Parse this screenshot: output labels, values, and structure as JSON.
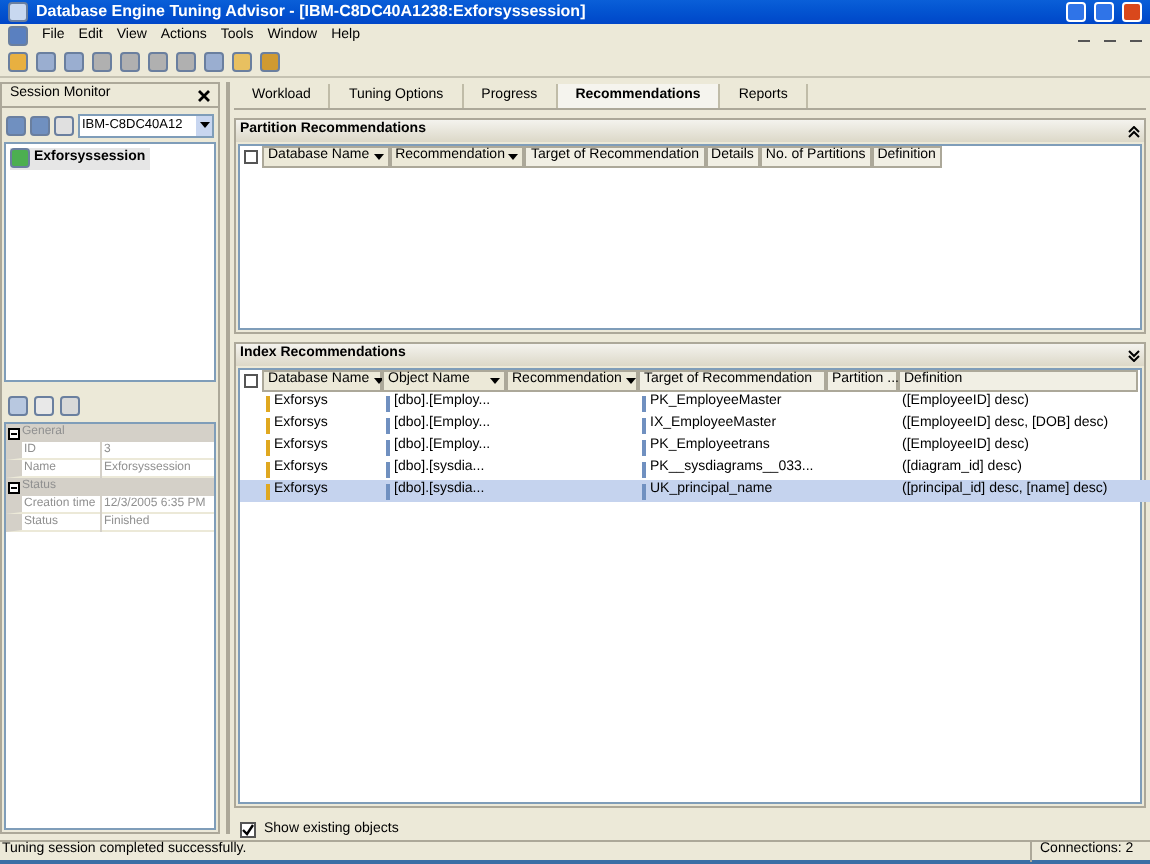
{
  "window": {
    "title": "Database Engine Tuning Advisor - [IBM-C8DC40A1238:Exforsyssession]"
  },
  "menu": [
    "File",
    "Edit",
    "View",
    "Actions",
    "Tools",
    "Window",
    "Help"
  ],
  "session_monitor": {
    "title": "Session Monitor",
    "server": "IBM-C8DC40A12",
    "sessions": [
      {
        "label": "Exforsyssession",
        "selected": true
      }
    ],
    "properties": [
      {
        "category": "General",
        "rows": [
          {
            "name": "ID",
            "value": "3"
          },
          {
            "name": "Name",
            "value": "Exforsyssession"
          }
        ]
      },
      {
        "category": "Status",
        "rows": [
          {
            "name": "Creation time",
            "value": "12/3/2005 6:35 PM"
          },
          {
            "name": "Status",
            "value": "Finished"
          }
        ]
      }
    ]
  },
  "tabs": [
    {
      "label": "Workload",
      "selected": false
    },
    {
      "label": "Tuning Options",
      "selected": false
    },
    {
      "label": "Progress",
      "selected": false
    },
    {
      "label": "Recommendations",
      "selected": true
    },
    {
      "label": "Reports",
      "selected": false
    }
  ],
  "partition_recommendations": {
    "title": "Partition Recommendations",
    "select_all_checked": false,
    "columns": [
      {
        "label": "Database Name",
        "dropdown": true
      },
      {
        "label": "Recommendation",
        "dropdown": true
      },
      {
        "label": "Target of Recommendation",
        "dropdown": false
      },
      {
        "label": "Details",
        "dropdown": false
      },
      {
        "label": "No. of Partitions",
        "dropdown": false
      },
      {
        "label": "Definition",
        "dropdown": false
      }
    ]
  },
  "index_recommendations": {
    "title": "Index Recommendations",
    "select_all_checked": false,
    "columns": [
      {
        "label": "Database Name",
        "dropdown": true
      },
      {
        "label": "Object Name",
        "dropdown": true
      },
      {
        "label": "Recommendation",
        "dropdown": true
      },
      {
        "label": "Target of Recommendation",
        "dropdown": false
      },
      {
        "label": "Partition ...",
        "dropdown": false
      },
      {
        "label": "Definition",
        "dropdown": false
      }
    ],
    "rows": [
      {
        "database": "Exforsys",
        "object": "[dbo].[Employ...",
        "target": "PK_EmployeeMaster",
        "definition": "([EmployeeID] desc)",
        "selected": false
      },
      {
        "database": "Exforsys",
        "object": "[dbo].[Employ...",
        "target": "IX_EmployeeMaster",
        "definition": "([EmployeeID] desc, [DOB] desc)",
        "selected": false
      },
      {
        "database": "Exforsys",
        "object": "[dbo].[Employ...",
        "target": "PK_Employeetrans",
        "definition": "([EmployeeID] desc)",
        "selected": false
      },
      {
        "database": "Exforsys",
        "object": "[dbo].[sysdia...",
        "target": "PK__sysdiagrams__033...",
        "definition": "([diagram_id] desc)",
        "selected": false
      },
      {
        "database": "Exforsys",
        "object": "[dbo].[sysdia...",
        "target": "UK_principal_name",
        "definition": "([principal_id] desc, [name] desc)",
        "selected": true
      }
    ]
  },
  "show_existing_objects": {
    "label": "Show existing objects",
    "checked": true
  },
  "status_bar": {
    "message": "Tuning session completed successfully.",
    "connections": "Connections: 2"
  }
}
